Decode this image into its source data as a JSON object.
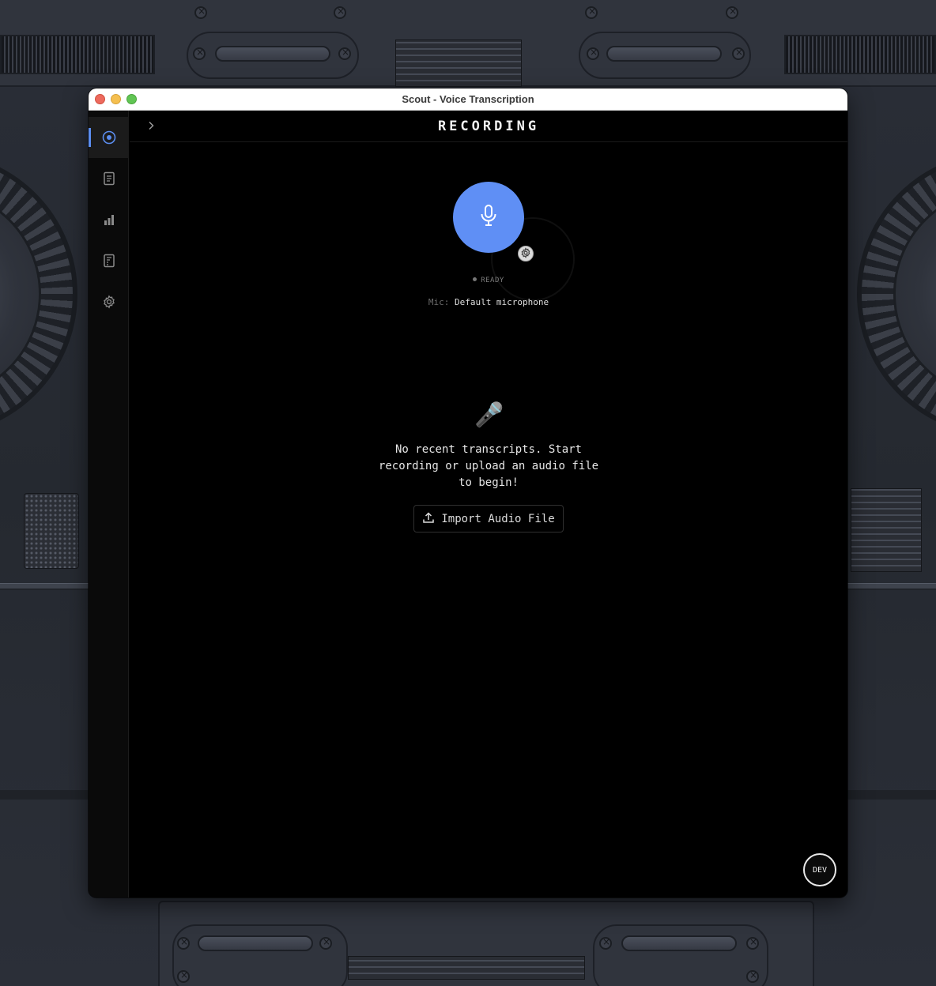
{
  "window": {
    "title": "Scout - Voice Transcription"
  },
  "sidebar": {
    "items": [
      {
        "id": "record",
        "icon": "record-icon",
        "active": true
      },
      {
        "id": "transcripts",
        "icon": "document-icon",
        "active": false
      },
      {
        "id": "stats",
        "icon": "bar-chart-icon",
        "active": false
      },
      {
        "id": "dictionary",
        "icon": "notebook-icon",
        "active": false
      },
      {
        "id": "settings",
        "icon": "gear-icon",
        "active": false
      }
    ]
  },
  "header": {
    "title": "RECORDING",
    "expand_icon": "chevron-right-icon"
  },
  "recorder": {
    "button_icon": "microphone-icon",
    "settings_icon": "gear-icon",
    "status": "READY",
    "mic_label": "Mic:",
    "mic_value": "Default microphone"
  },
  "empty_state": {
    "icon": "🎤",
    "message": "No recent transcripts. Start recording or upload an audio file to begin!",
    "import_label": "Import Audio File",
    "import_icon": "upload-icon"
  },
  "dev_badge": "DEV",
  "colors": {
    "accent": "#5f8ff5",
    "background": "#000000",
    "sidebar": "#0a0a0a"
  }
}
